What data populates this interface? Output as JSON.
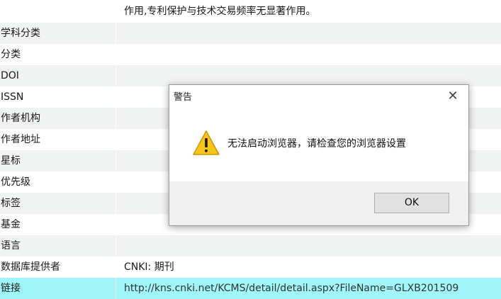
{
  "abstract": {
    "line": "作用,专利保护与技术交易频率无显著作用。"
  },
  "fields": [
    {
      "label": "学科分类",
      "value": ""
    },
    {
      "label": "分类",
      "value": ""
    },
    {
      "label": "DOI",
      "value": ""
    },
    {
      "label": "ISSN",
      "value": ""
    },
    {
      "label": "作者机构",
      "value": ""
    },
    {
      "label": "作者地址",
      "value": ""
    },
    {
      "label": "星标",
      "value": ""
    },
    {
      "label": "优先级",
      "value": ""
    },
    {
      "label": "标签",
      "value": ""
    },
    {
      "label": "基金",
      "value": ""
    },
    {
      "label": "语言",
      "value": ""
    },
    {
      "label": "数据库提供者",
      "value": "CNKI: 期刊"
    },
    {
      "label": "链接",
      "value": "http://kns.cnki.net/KCMS/detail/detail.aspx?FileName=GLXB201509"
    }
  ],
  "dialog": {
    "title": "警告",
    "close_glyph": "✕",
    "message": "无法启动浏览器，请检查您的浏览器设置",
    "ok_label": "OK",
    "icon": "warning-icon",
    "colors": {
      "warning_fill": "#f5c518",
      "warning_stroke": "#c99700"
    }
  },
  "colors": {
    "row_alt": "#f1f2f2",
    "row_selected": "#9ff5f7"
  }
}
